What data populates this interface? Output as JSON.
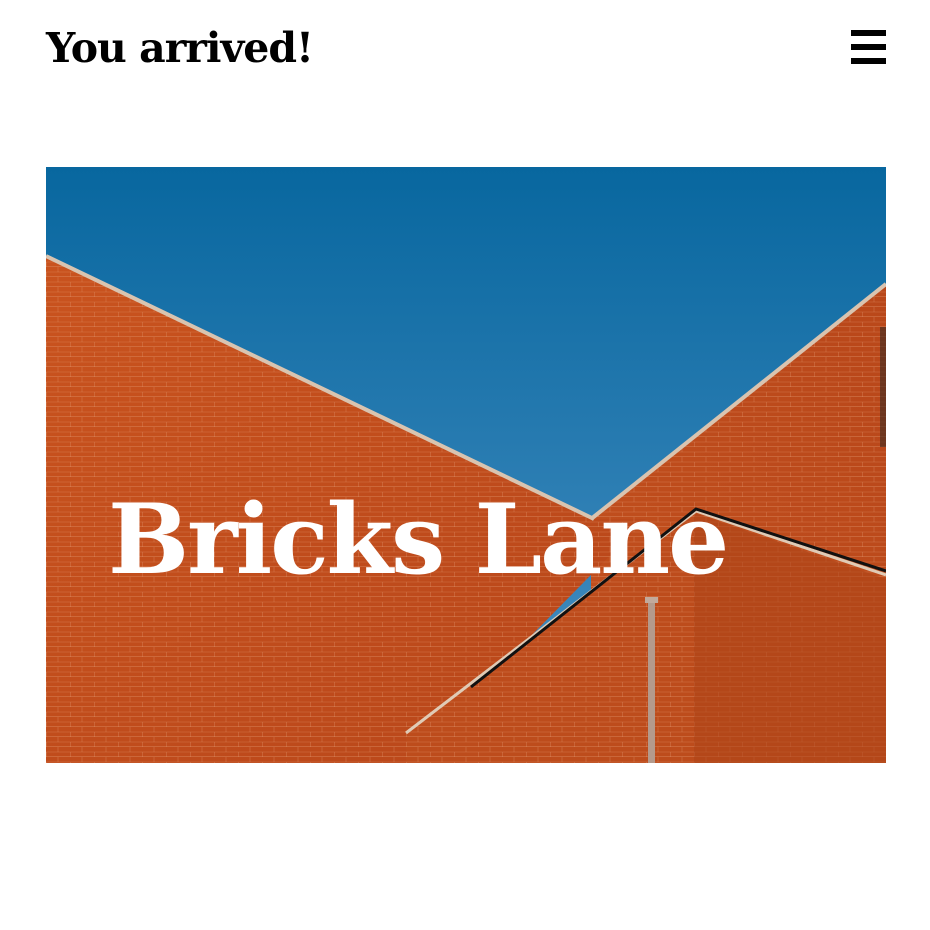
{
  "header": {
    "title": "You arrived!",
    "menu_icon": "hamburger-menu-icon"
  },
  "hero": {
    "title": "Bricks Lane",
    "image": "red-brick-buildings-against-blue-sky"
  },
  "colors": {
    "sky_top": "#08679f",
    "sky_bottom": "#3f8ac0",
    "brick": "#c4511f",
    "brick_dark": "#a63f17",
    "text_dark": "#000000",
    "text_light": "#ffffff"
  }
}
